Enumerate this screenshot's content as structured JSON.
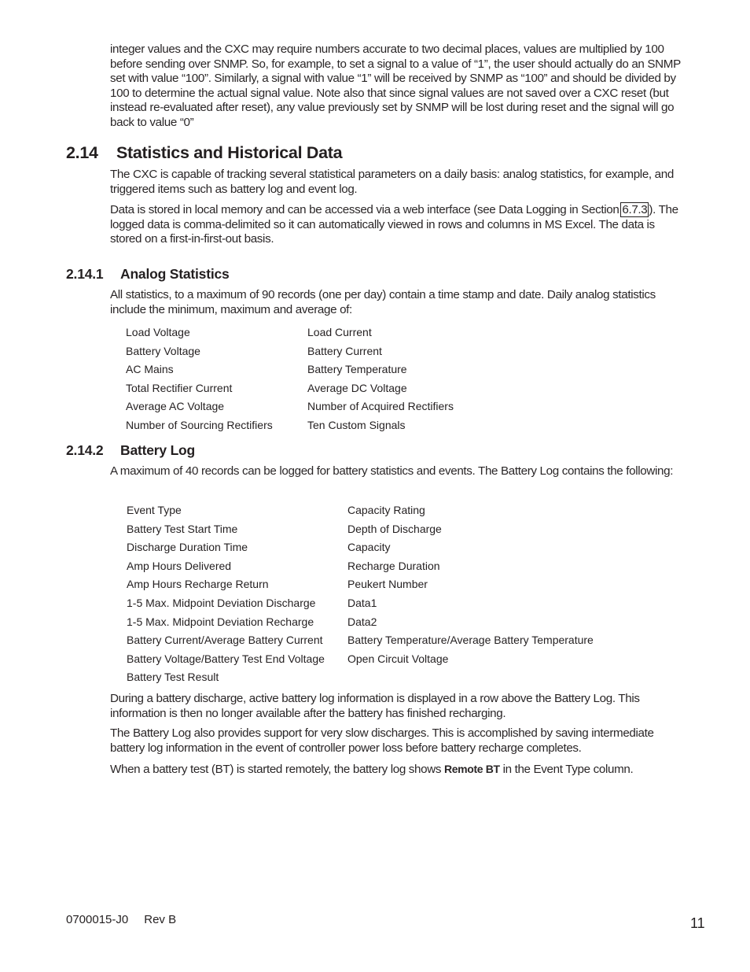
{
  "intro_paragraph": "integer values and the CXC may require numbers accurate to two decimal places, values are multiplied by 100 before sending over SNMP. So, for example, to set a signal to a value of “1”, the user should actually do an SNMP set with value “100”. Similarly, a signal with value “1” will be received by SNMP as “100” and should be divided by 100 to determine the actual signal value. Note also that since signal values are not saved over a CXC reset (but instead re-evaluated after reset), any value previously set by SNMP will be lost during reset and the signal will go back to value “0”",
  "section_2_14": {
    "number": "2.14",
    "title": "Statistics and Historical Data",
    "para1": "The CXC is capable of tracking several statistical parameters on a daily basis: analog statistics, for example, and triggered items such as battery log and event log.",
    "para2_before": "Data is stored in local memory and can be accessed via a web interface (see Data Logging in Section ",
    "para2_xref": "6.7.3",
    "para2_after": "). The logged data is comma-delimited so it can automatically viewed in rows and columns in MS Excel. The data is stored on a first-in-first-out basis."
  },
  "section_2_14_1": {
    "number": "2.14.1",
    "title": "Analog Statistics",
    "para": "All statistics, to a maximum of 90 records (one per day) contain a time stamp and date. Daily analog statistics include the minimum, maximum and average of:",
    "items": [
      [
        "Load Voltage",
        "Load Current"
      ],
      [
        "Battery Voltage",
        "Battery Current"
      ],
      [
        "AC Mains",
        "Battery Temperature"
      ],
      [
        "Total Rectifier Current",
        "Average DC Voltage"
      ],
      [
        "Average AC Voltage",
        "Number of Acquired Rectifiers"
      ],
      [
        "Number of Sourcing Rectifiers",
        "Ten Custom Signals"
      ]
    ]
  },
  "section_2_14_2": {
    "number": "2.14.2",
    "title": "Battery Log",
    "para": "A maximum of 40 records can be logged for battery statistics and events. The Battery Log contains the following:",
    "items": [
      [
        "Event Type",
        "Capacity Rating"
      ],
      [
        "Battery Test Start Time",
        "Depth of Discharge"
      ],
      [
        "Discharge Duration Time",
        "Capacity"
      ],
      [
        "Amp Hours Delivered",
        "Recharge Duration"
      ],
      [
        "Amp Hours Recharge Return",
        "Peukert Number"
      ],
      [
        "1-5 Max. Midpoint Deviation Discharge",
        "Data1"
      ],
      [
        "1-5 Max. Midpoint Deviation Recharge",
        "Data2"
      ],
      [
        "Battery Current/Average Battery Current",
        "Battery Temperature/Average Battery Temperature"
      ],
      [
        "Battery Voltage/Battery Test End Voltage",
        "Open Circuit Voltage"
      ],
      [
        "Battery Test Result",
        ""
      ]
    ],
    "para_discharge": "During a battery discharge, active battery log information is displayed in a row above the Battery Log. This information is then no longer available after the battery has finished recharging.",
    "para_slow": "The Battery Log also provides support for very slow discharges. This is accomplished by saving intermediate battery log information in the event of controller power loss before battery recharge completes.",
    "para_remote_before": "When a battery test (BT) is started remotely, the battery log shows ",
    "para_remote_bold": "Remote BT",
    "para_remote_after": " in the Event Type column."
  },
  "footer": {
    "doc_number": "0700015-J0",
    "revision": "Rev B",
    "page_number": "11"
  }
}
